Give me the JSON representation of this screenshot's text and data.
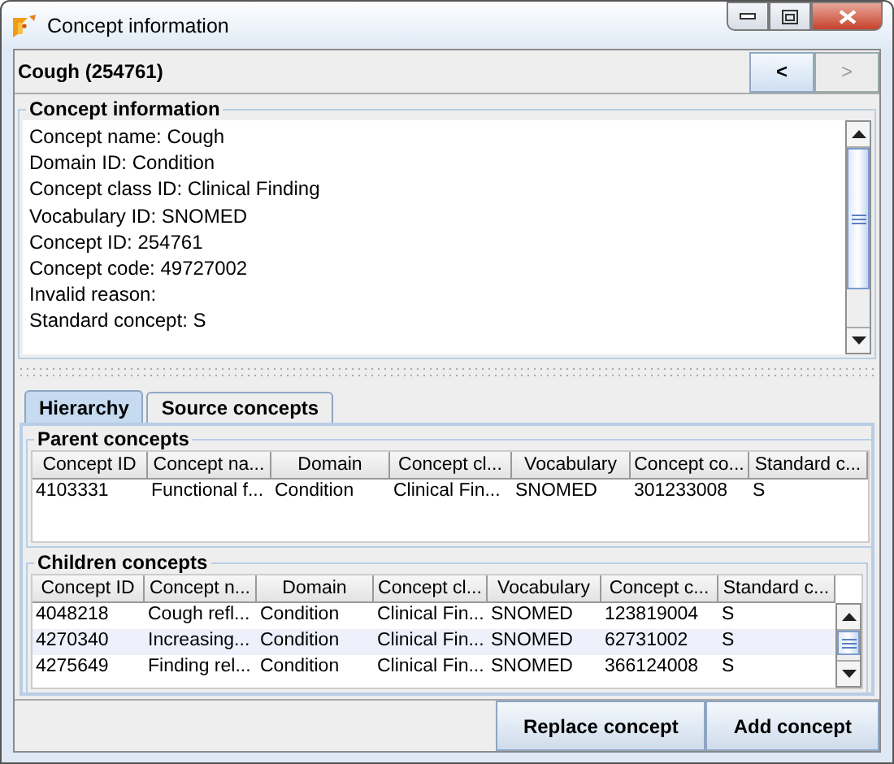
{
  "window": {
    "title": "Concept information"
  },
  "header": {
    "title": "Cough (254761)",
    "nav": [
      {
        "label": "<",
        "disabled": false
      },
      {
        "label": ">",
        "disabled": true
      }
    ]
  },
  "concept_info": {
    "title": "Concept information",
    "lines": [
      "Concept name: Cough",
      "Domain ID: Condition",
      "Concept class ID: Clinical Finding",
      "Vocabulary ID: SNOMED",
      "Concept ID: 254761",
      "Concept code: 49727002",
      "Invalid reason:",
      "Standard concept: S"
    ]
  },
  "tabs": [
    {
      "label": "Hierarchy",
      "selected": true
    },
    {
      "label": "Source concepts",
      "selected": false
    }
  ],
  "parent_concepts": {
    "title": "Parent concepts",
    "columns": [
      "Concept ID",
      "Concept na...",
      "Domain",
      "Concept cl...",
      "Vocabulary",
      "Concept co...",
      "Standard c..."
    ],
    "rows": [
      [
        "4103331",
        "Functional f...",
        "Condition",
        "Clinical Fin...",
        "SNOMED",
        "301233008",
        "S"
      ]
    ]
  },
  "children_concepts": {
    "title": "Children concepts",
    "columns": [
      "Concept ID",
      "Concept n...",
      "Domain",
      "Concept cl...",
      "Vocabulary",
      "Concept c...",
      "Standard c..."
    ],
    "rows": [
      [
        "4048218",
        "Cough refl...",
        "Condition",
        "Clinical Fin...",
        "SNOMED",
        "123819004",
        "S"
      ],
      [
        "4270340",
        "Increasing...",
        "Condition",
        "Clinical Fin...",
        "SNOMED",
        "62731002",
        "S"
      ],
      [
        "4275649",
        "Finding rel...",
        "Condition",
        "Clinical Fin...",
        "SNOMED",
        "366124008",
        "S"
      ]
    ]
  },
  "buttons": [
    "Replace concept",
    "Add concept"
  ]
}
